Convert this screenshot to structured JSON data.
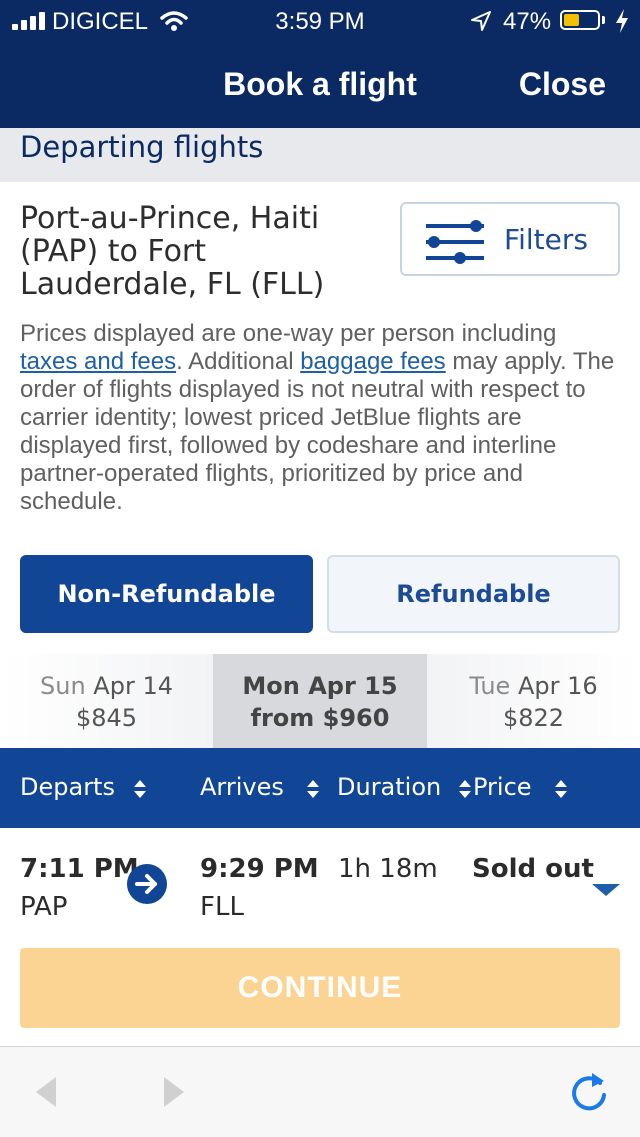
{
  "status_bar": {
    "carrier": "DIGICEL",
    "time": "3:59 PM",
    "battery": "47%",
    "battery_level": 0.47
  },
  "nav": {
    "title": "Book a flight",
    "close_label": "Close"
  },
  "section_header": "Departing flights",
  "route": "Port-au-Prince, Haiti (PAP) to Fort Lauderdale, FL (FLL)",
  "filters_label": "Filters",
  "notice": {
    "part1": "Prices displayed are one-way per person including ",
    "link1": "taxes and fees",
    "part2": ". Additional ",
    "link2": "baggage fees",
    "part3": " may apply. The order of flights displayed is not neutral with respect to carrier identity; lowest priced JetBlue flights are displayed first, followed by codeshare and interline partner-operated flights, prioritized by price and schedule."
  },
  "fare_tabs": {
    "non_refundable": "Non-Refundable",
    "refundable": "Refundable"
  },
  "dates": [
    {
      "day": "Sun",
      "date": "Apr 14",
      "price": "$845"
    },
    {
      "day": "Mon",
      "date": "Apr 15",
      "price": "from $960"
    },
    {
      "day": "Tue",
      "date": "Apr 16",
      "price": "$822"
    }
  ],
  "columns": {
    "departs": "Departs",
    "arrives": "Arrives",
    "duration": "Duration",
    "price": "Price"
  },
  "flight": {
    "depart_time": "7:11 PM",
    "depart_code": "PAP",
    "arrive_time": "9:29 PM",
    "arrive_code": "FLL",
    "duration": "1h 18m",
    "status": "Sold out"
  },
  "continue_label": "CONTINUE",
  "colors": {
    "navy": "#0b2a63",
    "brand_blue": "#114596",
    "link_blue": "#1d5fa8",
    "continue_disabled": "#fbd494",
    "battery_yellow": "#f5c000"
  },
  "icons": [
    "signal-icon",
    "wifi-icon",
    "location-arrow-icon",
    "battery-icon",
    "charging-icon",
    "filters-icon",
    "sort-icon",
    "arrow-right-circle-icon",
    "chevron-down-icon",
    "back-icon",
    "forward-icon",
    "reload-icon"
  ]
}
